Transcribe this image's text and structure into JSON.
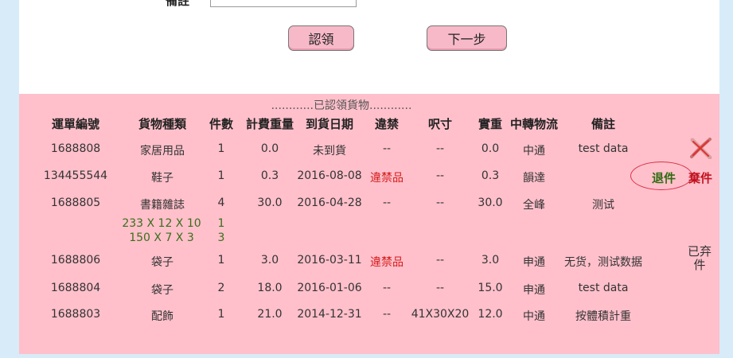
{
  "form": {
    "remark_label": "備註",
    "remark_value": "",
    "claim_button": "認領",
    "next_button": "下一步"
  },
  "claimed": {
    "title": "............已認領貨物............",
    "headers": [
      "運單編號",
      "貨物種類",
      "件數",
      "計費重量",
      "到貨日期",
      "違禁",
      "呎寸",
      "實重",
      "中轉物流",
      "備註"
    ],
    "rows": [
      {
        "id": "1688808",
        "type": "家居用品",
        "qty": "1",
        "charge_weight": "0.0",
        "arrival": "未到貨",
        "contraband": "--",
        "dims": "--",
        "weight": "0.0",
        "logistics": "中通",
        "remark": "test data"
      },
      {
        "id": "134455544",
        "type": "鞋子",
        "qty": "1",
        "charge_weight": "0.3",
        "arrival": "2016-08-08",
        "contraband": "違禁品",
        "dims": "--",
        "weight": "0.3",
        "logistics": "韻達",
        "remark": ""
      },
      {
        "id": "1688805",
        "type": "書籍雜誌",
        "qty": "4",
        "charge_weight": "30.0",
        "arrival": "2016-04-28",
        "contraband": "--",
        "dims": "--",
        "weight": "30.0",
        "logistics": "全峰",
        "remark": "测试"
      },
      {
        "id": "1688806",
        "type": "袋子",
        "qty": "1",
        "charge_weight": "3.0",
        "arrival": "2016-03-11",
        "contraband": "違禁品",
        "dims": "--",
        "weight": "3.0",
        "logistics": "申通",
        "remark": "无货，测试数据"
      },
      {
        "id": "1688804",
        "type": "袋子",
        "qty": "2",
        "charge_weight": "18.0",
        "arrival": "2016-01-06",
        "contraband": "--",
        "dims": "--",
        "weight": "15.0",
        "logistics": "申通",
        "remark": "test data"
      },
      {
        "id": "1688803",
        "type": "配飾",
        "qty": "1",
        "charge_weight": "21.0",
        "arrival": "2014-12-31",
        "contraband": "--",
        "dims": "41X30X20",
        "weight": "12.0",
        "logistics": "中通",
        "remark": "按體積計重"
      }
    ],
    "sub_items": [
      {
        "dims": "233 X 12 X 10",
        "qty": "1"
      },
      {
        "dims": "150 X 7 X 3",
        "qty": "3"
      }
    ],
    "actions": {
      "return_label": "退件",
      "abandon_label": "棄件",
      "abandoned_status": "已弃件",
      "delete_icon": "red-x-icon"
    }
  },
  "colors": {
    "page_bg": "#d7ecf8",
    "panel_bg": "#ffc0cb",
    "button_bg": "#f7b9c8",
    "contraband_red": "#d41c1c",
    "return_green": "#2e6b10"
  }
}
